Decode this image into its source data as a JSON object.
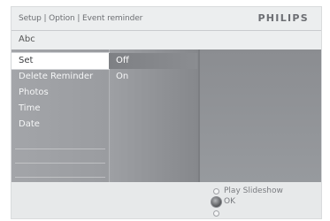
{
  "header": {
    "breadcrumb": "Setup | Option | Event reminder",
    "brand": "PHILIPS"
  },
  "title": "Abc",
  "menu": {
    "items": [
      {
        "label": "Set",
        "selected": true
      },
      {
        "label": "Delete Reminder",
        "selected": false
      },
      {
        "label": "Photos",
        "selected": false
      },
      {
        "label": "Time",
        "selected": false
      },
      {
        "label": "Date",
        "selected": false
      }
    ]
  },
  "submenu": {
    "items": [
      {
        "label": "Off",
        "highlighted": true
      },
      {
        "label": "On",
        "highlighted": false
      }
    ]
  },
  "footer": {
    "hints": [
      {
        "icon": "up-button-icon",
        "label": "Play Slideshow"
      },
      {
        "icon": "ok-button-icon",
        "label": "OK"
      },
      {
        "icon": "down-button-icon",
        "label": ""
      }
    ]
  }
}
